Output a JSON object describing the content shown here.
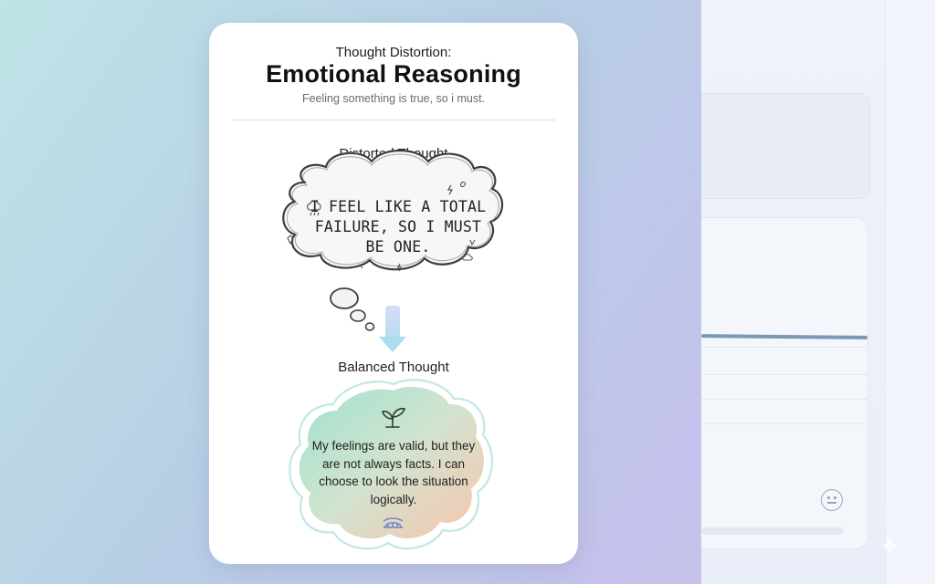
{
  "card": {
    "kicker": "Thought Distortion:",
    "title": "Emotional Reasoning",
    "subtitle": "Feeling something is true, so i must.",
    "distorted_label": "Distorted Thought",
    "distorted_text": "I FEEL LIKE A TOTAL FAILURE, SO I MUST BE ONE.",
    "balanced_label": "Balanced Thought",
    "balanced_text": "My feelings are valid, but they are not always facts. I can choose to look the situation logically."
  },
  "icons": {
    "sprout": "sprout-icon",
    "bridge": "bridge-icon",
    "arrow": "arrow-down-icon",
    "rain_cloud": "rain-cloud-icon",
    "lightning": "lightning-icon",
    "smiley": "neutral-face-icon",
    "sparkle": "sparkle-icon"
  },
  "colors": {
    "card_bg": "#ffffff",
    "balanced_mint": "#a9e6d3",
    "balanced_peach": "#f4c9b2",
    "arrow": "#b9c6ee",
    "sketch_gray": "#444444"
  }
}
